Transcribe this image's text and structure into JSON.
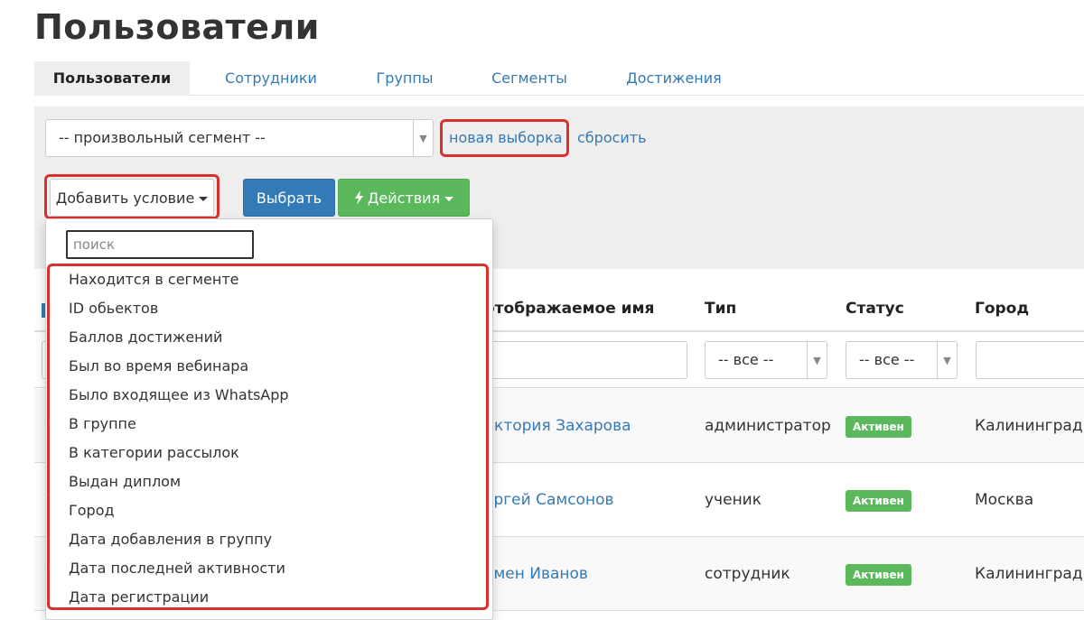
{
  "page": {
    "title": "Пользователи"
  },
  "tabs": [
    {
      "label": "Пользователи",
      "active": true
    },
    {
      "label": "Сотрудники"
    },
    {
      "label": "Группы"
    },
    {
      "label": "Сегменты"
    },
    {
      "label": "Достижения"
    }
  ],
  "filter": {
    "segment_value": "-- произвольный сегмент --",
    "new_selection_label": "новая выборка",
    "reset_label": "сбросить"
  },
  "toolbar": {
    "add_condition_label": "Добавить условие",
    "select_label": "Выбрать",
    "actions_label": "Действия"
  },
  "dropdown": {
    "search_placeholder": "поиск",
    "items": [
      "Находится в сегменте",
      "ID обьектов",
      "Баллов достижений",
      "Был во время вебинара",
      "Было входящее из WhatsApp",
      "В группе",
      "В категории рассылок",
      "Выдан диплом",
      "Город",
      "Дата добавления в группу",
      "Дата последней активности",
      "Дата регистрации"
    ]
  },
  "table": {
    "columns": {
      "display_name": "отображаемое имя",
      "type": "Тип",
      "status": "Статус",
      "city": "Город"
    },
    "filters": {
      "type": "-- все --",
      "status": "-- все --"
    },
    "rows": [
      {
        "name": "иктория Захарова",
        "type": "администратор",
        "status": "Активен",
        "city": "Калининград"
      },
      {
        "name": "ергей Самсонов",
        "type": "ученик",
        "status": "Активен",
        "city": "Москва"
      },
      {
        "name": "емен Иванов",
        "type": "сотрудник",
        "status": "Активен",
        "city": "Калининград"
      }
    ]
  },
  "colors": {
    "link": "#337ab7",
    "primary": "#337ab7",
    "success": "#5cb85c",
    "highlight": "#d9302c",
    "panel": "#eeeeee"
  }
}
